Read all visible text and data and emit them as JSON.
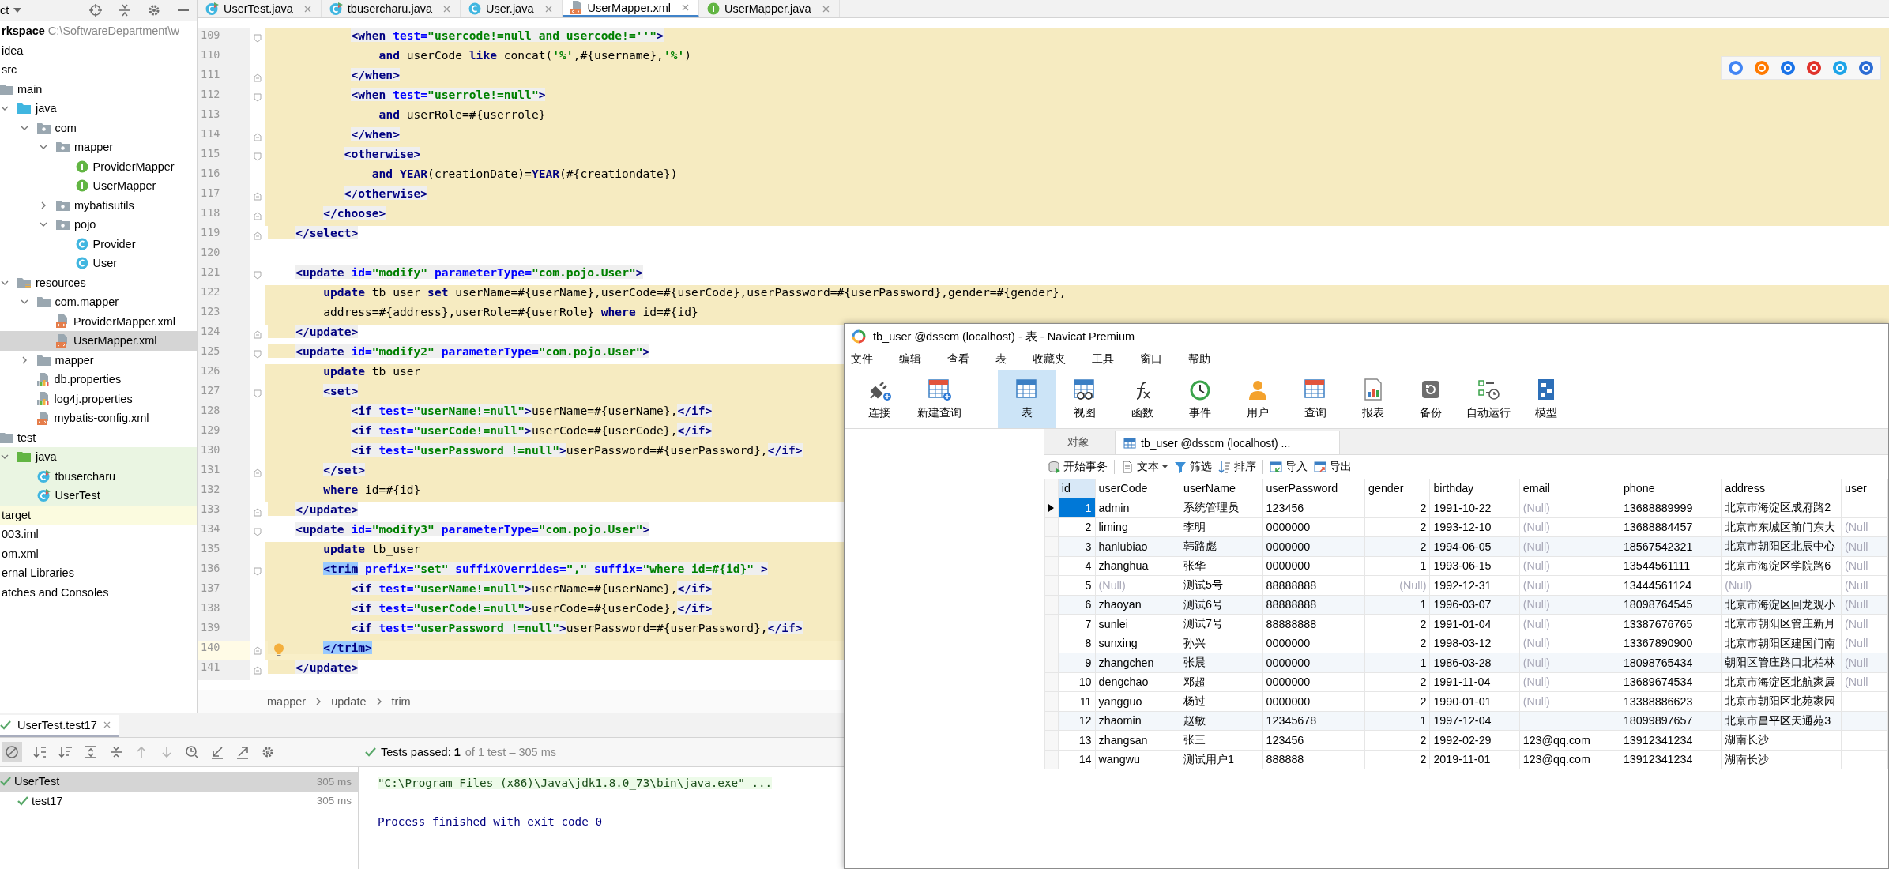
{
  "project": {
    "header": "ct",
    "tree": [
      {
        "label": "rkspace",
        "path": "C:\\SoftwareDepartment\\w",
        "selected": false,
        "children": [
          {
            "label": "idea",
            "selected": false
          },
          {
            "label": "src",
            "selected": false,
            "children": [
              {
                "label": "main",
                "kind": "folder",
                "selected": false,
                "children": [
                  {
                    "label": "java",
                    "kind": "source",
                    "expanded": true,
                    "selected": false,
                    "children": [
                      {
                        "label": "com",
                        "kind": "package",
                        "expanded": true,
                        "selected": false,
                        "children": [
                          {
                            "label": "mapper",
                            "kind": "package",
                            "expanded": true,
                            "selected": false,
                            "children": [
                              {
                                "label": "ProviderMapper",
                                "kind": "interface",
                                "selected": false
                              },
                              {
                                "label": "UserMapper",
                                "kind": "interface",
                                "selected": false
                              }
                            ]
                          },
                          {
                            "label": "mybatisutils",
                            "kind": "package",
                            "expanded": false,
                            "selected": false
                          },
                          {
                            "label": "pojo",
                            "kind": "package",
                            "expanded": true,
                            "selected": false,
                            "children": [
                              {
                                "label": "Provider",
                                "kind": "class",
                                "selected": false
                              },
                              {
                                "label": "User",
                                "kind": "class",
                                "selected": false
                              }
                            ]
                          }
                        ]
                      }
                    ]
                  },
                  {
                    "label": "resources",
                    "kind": "resources",
                    "expanded": true,
                    "selected": false,
                    "children": [
                      {
                        "label": "com.mapper",
                        "kind": "folder",
                        "expanded": true,
                        "selected": false,
                        "children": [
                          {
                            "label": "ProviderMapper.xml",
                            "kind": "xml",
                            "selected": false
                          },
                          {
                            "label": "UserMapper.xml",
                            "kind": "xml",
                            "selected": true
                          }
                        ]
                      },
                      {
                        "label": "mapper",
                        "kind": "folder",
                        "expanded": false,
                        "selected": false
                      },
                      {
                        "label": "db.properties",
                        "kind": "properties",
                        "selected": false
                      },
                      {
                        "label": "log4j.properties",
                        "kind": "properties",
                        "selected": false
                      },
                      {
                        "label": "mybatis-config.xml",
                        "kind": "xml",
                        "selected": false
                      }
                    ]
                  }
                ]
              },
              {
                "label": "test",
                "kind": "folder",
                "selected": false,
                "children": [
                  {
                    "label": "java",
                    "kind": "test-source",
                    "expanded": true,
                    "test_root": true,
                    "selected": false,
                    "children": [
                      {
                        "label": "tbusercharu",
                        "kind": "test-class",
                        "selected": false
                      },
                      {
                        "label": "UserTest",
                        "kind": "test-class",
                        "selected": false
                      }
                    ]
                  }
                ]
              }
            ]
          },
          {
            "label": "target",
            "excluded": true,
            "selected": false
          },
          {
            "label": "003.iml",
            "selected": false
          },
          {
            "label": "om.xml",
            "selected": false
          }
        ]
      },
      {
        "label": "ernal Libraries",
        "selected": false
      },
      {
        "label": "atches and Consoles",
        "selected": false
      }
    ]
  },
  "editor": {
    "tabs": [
      {
        "label": "UserTest.java",
        "kind": "test-class",
        "selected": false
      },
      {
        "label": "tbusercharu.java",
        "kind": "test-class",
        "selected": false
      },
      {
        "label": "User.java",
        "kind": "class",
        "selected": false
      },
      {
        "label": "UserMapper.xml",
        "kind": "xml",
        "selected": true
      },
      {
        "label": "UserMapper.java",
        "kind": "interface",
        "selected": false
      }
    ],
    "lines": [
      {
        "n": "109",
        "kind": "full",
        "current": false,
        "fold_start": true,
        "segs": [
          {
            "kind": "tag",
            "text": "            <when"
          },
          {
            "kind": "attr",
            "text": " test="
          },
          {
            "kind": "val",
            "text": "\"usercode!=null and usercode!=''\""
          },
          {
            "kind": "tag",
            "text": ">"
          }
        ]
      },
      {
        "n": "110",
        "kind": "full",
        "current": false,
        "segs": [
          {
            "kind": "kw",
            "text": "                and"
          },
          {
            "kind": "text",
            "text": " userCode "
          },
          {
            "kind": "kw",
            "text": "like"
          },
          {
            "kind": "text",
            "text": " concat("
          },
          {
            "kind": "str",
            "text": "'%'"
          },
          {
            "kind": "text",
            "text": ",#{username},"
          },
          {
            "kind": "str",
            "text": "'%'"
          },
          {
            "kind": "text",
            "text": ")"
          }
        ]
      },
      {
        "n": "111",
        "kind": "full",
        "current": false,
        "fold_end": true,
        "segs": [
          {
            "kind": "tag",
            "text": "            </when>"
          }
        ]
      },
      {
        "n": "112",
        "kind": "full",
        "current": false,
        "fold_start": true,
        "segs": [
          {
            "kind": "tag",
            "text": "            <when"
          },
          {
            "kind": "attr",
            "text": " test="
          },
          {
            "kind": "val",
            "text": "\"userrole!=null\""
          },
          {
            "kind": "tag",
            "text": ">"
          }
        ]
      },
      {
        "n": "113",
        "kind": "full",
        "current": false,
        "segs": [
          {
            "kind": "kw",
            "text": "                and"
          },
          {
            "kind": "text",
            "text": " userRole=#{userrole}"
          }
        ]
      },
      {
        "n": "114",
        "kind": "full",
        "current": false,
        "fold_end": true,
        "segs": [
          {
            "kind": "tag",
            "text": "            </when>"
          }
        ]
      },
      {
        "n": "115",
        "kind": "full",
        "current": false,
        "fold_start": true,
        "segs": [
          {
            "kind": "tag",
            "text": "           <otherwise>"
          }
        ]
      },
      {
        "n": "116",
        "kind": "full",
        "current": false,
        "segs": [
          {
            "kind": "kw",
            "text": "               and YEAR"
          },
          {
            "kind": "text",
            "text": "(creationDate)="
          },
          {
            "kind": "kw",
            "text": "YEAR"
          },
          {
            "kind": "text",
            "text": "(#{creationdate})"
          }
        ]
      },
      {
        "n": "117",
        "kind": "full",
        "current": false,
        "fold_end": true,
        "segs": [
          {
            "kind": "tag",
            "text": "           </otherwise>"
          }
        ]
      },
      {
        "n": "118",
        "kind": "full",
        "current": false,
        "fold_end": true,
        "segs": [
          {
            "kind": "tag",
            "text": "        </choose>"
          }
        ]
      },
      {
        "n": "119",
        "kind": "indent",
        "current": false,
        "fold_end": true,
        "segs": [
          {
            "kind": "tag",
            "text": "    </select>"
          }
        ]
      },
      {
        "n": "120",
        "kind": "none",
        "current": false
      },
      {
        "n": "121",
        "kind": "none",
        "current": false,
        "fold_start": true,
        "segs": [
          {
            "kind": "tag",
            "text": "    <update"
          },
          {
            "kind": "attr",
            "text": " id="
          },
          {
            "kind": "val",
            "text": "\"modify\""
          },
          {
            "kind": "attr",
            "text": " parameterType="
          },
          {
            "kind": "val",
            "text": "\"com.pojo.User\""
          },
          {
            "kind": "tag",
            "text": ">"
          }
        ]
      },
      {
        "n": "122",
        "kind": "full",
        "current": false,
        "segs": [
          {
            "kind": "kw",
            "text": "        update"
          },
          {
            "kind": "text",
            "text": " tb_user "
          },
          {
            "kind": "kw",
            "text": "set"
          },
          {
            "kind": "text",
            "text": " userName=#{userName},userCode=#{userCode},userPassword=#{userPassword},gender=#{gender},"
          }
        ]
      },
      {
        "n": "123",
        "kind": "full",
        "current": false,
        "segs": [
          {
            "kind": "text",
            "text": "        address=#{address},userRole=#{userRole} "
          },
          {
            "kind": "kw",
            "text": "where"
          },
          {
            "kind": "text",
            "text": " id=#{id}"
          }
        ]
      },
      {
        "n": "124",
        "kind": "indent",
        "current": false,
        "fold_end": true,
        "segs": [
          {
            "kind": "tag",
            "text": "    </update>"
          }
        ]
      },
      {
        "n": "125",
        "kind": "indent",
        "current": false,
        "fold_start": true,
        "segs": [
          {
            "kind": "tag",
            "text": "    <update"
          },
          {
            "kind": "attr",
            "text": " id="
          },
          {
            "kind": "val",
            "text": "\"modify2\""
          },
          {
            "kind": "attr",
            "text": " parameterType="
          },
          {
            "kind": "val",
            "text": "\"com.pojo.User\""
          },
          {
            "kind": "tag",
            "text": ">"
          }
        ]
      },
      {
        "n": "126",
        "kind": "full",
        "current": false,
        "segs": [
          {
            "kind": "kw",
            "text": "        update"
          },
          {
            "kind": "text",
            "text": " tb_user"
          }
        ]
      },
      {
        "n": "127",
        "kind": "full",
        "current": false,
        "fold_start": true,
        "segs": [
          {
            "kind": "tag",
            "text": "        <set>"
          }
        ]
      },
      {
        "n": "128",
        "kind": "full",
        "current": false,
        "segs": [
          {
            "kind": "tag",
            "text": "            <if"
          },
          {
            "kind": "attr",
            "text": " test="
          },
          {
            "kind": "val",
            "text": "\"userName!=null\""
          },
          {
            "kind": "tag",
            "text": ">"
          },
          {
            "kind": "text",
            "text": "userName=#{userName},"
          },
          {
            "kind": "tag",
            "text": "</if>"
          }
        ]
      },
      {
        "n": "129",
        "kind": "full",
        "current": false,
        "segs": [
          {
            "kind": "tag",
            "text": "            <if"
          },
          {
            "kind": "attr",
            "text": " test="
          },
          {
            "kind": "val",
            "text": "\"userCode!=null\""
          },
          {
            "kind": "tag",
            "text": ">"
          },
          {
            "kind": "text",
            "text": "userCode=#{userCode},"
          },
          {
            "kind": "tag",
            "text": "</if>"
          }
        ]
      },
      {
        "n": "130",
        "kind": "full",
        "current": false,
        "segs": [
          {
            "kind": "tag",
            "text": "            <if"
          },
          {
            "kind": "attr",
            "text": " test="
          },
          {
            "kind": "val",
            "text": "\"userPassword !=null\""
          },
          {
            "kind": "tag",
            "text": ">"
          },
          {
            "kind": "text",
            "text": "userPassword=#{userPassword},"
          },
          {
            "kind": "tag",
            "text": "</if>"
          }
        ]
      },
      {
        "n": "131",
        "kind": "full",
        "current": false,
        "fold_end": true,
        "segs": [
          {
            "kind": "tag",
            "text": "        </set>"
          }
        ]
      },
      {
        "n": "132",
        "kind": "full",
        "current": false,
        "segs": [
          {
            "kind": "kw",
            "text": "        where"
          },
          {
            "kind": "text",
            "text": " id=#{id}"
          }
        ]
      },
      {
        "n": "133",
        "kind": "indent",
        "current": false,
        "fold_end": true,
        "segs": [
          {
            "kind": "tag",
            "text": "    </update>"
          }
        ]
      },
      {
        "n": "134",
        "kind": "none",
        "current": false,
        "fold_start": true,
        "segs": [
          {
            "kind": "tag",
            "text": "    <update"
          },
          {
            "kind": "attr",
            "text": " id="
          },
          {
            "kind": "val",
            "text": "\"modify3\""
          },
          {
            "kind": "attr",
            "text": " parameterType="
          },
          {
            "kind": "val",
            "text": "\"com.pojo.User\""
          },
          {
            "kind": "tag",
            "text": ">"
          }
        ]
      },
      {
        "n": "135",
        "kind": "full",
        "current": false,
        "segs": [
          {
            "kind": "kw",
            "text": "        update"
          },
          {
            "kind": "text",
            "text": " tb_user"
          }
        ]
      },
      {
        "n": "136",
        "kind": "full",
        "current": false,
        "fold_start": true,
        "segs": [
          {
            "kind": "match",
            "text": "        <trim"
          },
          {
            "kind": "attr",
            "text": " prefix="
          },
          {
            "kind": "val",
            "text": "\"set\""
          },
          {
            "kind": "attr",
            "text": " suffixOverrides="
          },
          {
            "kind": "val",
            "text": "\",\""
          },
          {
            "kind": "attr",
            "text": " suffix="
          },
          {
            "kind": "val",
            "text": "\"where id=#{id}\""
          },
          {
            "kind": "tag",
            "text": " >"
          }
        ]
      },
      {
        "n": "137",
        "kind": "full",
        "current": false,
        "segs": [
          {
            "kind": "tag",
            "text": "            <if"
          },
          {
            "kind": "attr",
            "text": " test="
          },
          {
            "kind": "val",
            "text": "\"userName!=null\""
          },
          {
            "kind": "tag",
            "text": ">"
          },
          {
            "kind": "text",
            "text": "userName=#{userName},"
          },
          {
            "kind": "tag",
            "text": "</if>"
          }
        ]
      },
      {
        "n": "138",
        "kind": "full",
        "current": false,
        "segs": [
          {
            "kind": "tag",
            "text": "            <if"
          },
          {
            "kind": "attr",
            "text": " test="
          },
          {
            "kind": "val",
            "text": "\"userCode!=null\""
          },
          {
            "kind": "tag",
            "text": ">"
          },
          {
            "kind": "text",
            "text": "userCode=#{userCode},"
          },
          {
            "kind": "tag",
            "text": "</if>"
          }
        ]
      },
      {
        "n": "139",
        "kind": "full",
        "current": false,
        "segs": [
          {
            "kind": "tag",
            "text": "            <if"
          },
          {
            "kind": "attr",
            "text": " test="
          },
          {
            "kind": "val",
            "text": "\"userPassword !=null\""
          },
          {
            "kind": "tag",
            "text": ">"
          },
          {
            "kind": "text",
            "text": "userPassword=#{userPassword},"
          },
          {
            "kind": "tag",
            "text": "</if>"
          }
        ]
      },
      {
        "n": "140",
        "kind": "full",
        "current": true,
        "fold_end": true,
        "segs": [
          {
            "kind": "match",
            "text": "        </trim>"
          }
        ]
      },
      {
        "n": "141",
        "kind": "indent",
        "current": false,
        "fold_end": true,
        "segs": [
          {
            "kind": "tag",
            "text": "    </update>"
          }
        ]
      }
    ],
    "breadcrumb": [
      "mapper",
      "update",
      "trim"
    ]
  },
  "run": {
    "tab": "UserTest.test17",
    "status": "Tests passed: **1**",
    "status_detail": "of 1 test – 305 ms",
    "tests": [
      {
        "name": "UserTest",
        "time": "305 ms",
        "selected": true,
        "children": [
          {
            "name": "test17",
            "time": "305 ms",
            "selected": false
          }
        ]
      }
    ],
    "console": [
      {
        "text": "\"C:\\Program Files (x86)\\Java\\jdk1.8.0_73\\bin\\java.exe\" ...",
        "kind": "command"
      },
      {
        "text": "Process finished with exit code 0",
        "kind": "exit"
      }
    ]
  },
  "navicat": {
    "title": "tb_user @dsscm (localhost) - 表 - Navicat Premium",
    "menu": [
      "文件",
      "编辑",
      "查看",
      "表",
      "收藏夹",
      "工具",
      "窗口",
      "帮助"
    ],
    "toolbar": [
      {
        "label": "连接",
        "kind": "connect",
        "selected": false
      },
      {
        "label": "新建查询",
        "kind": "new-query",
        "selected": false
      },
      {
        "label": "表",
        "kind": "table",
        "selected": true
      },
      {
        "label": "视图",
        "kind": "view",
        "selected": false
      },
      {
        "label": "函数",
        "kind": "function",
        "selected": false
      },
      {
        "label": "事件",
        "kind": "event",
        "selected": false
      },
      {
        "label": "用户",
        "kind": "user",
        "selected": false
      },
      {
        "label": "查询",
        "kind": "query",
        "selected": false
      },
      {
        "label": "报表",
        "kind": "report",
        "selected": false
      },
      {
        "label": "备份",
        "kind": "backup",
        "selected": false
      },
      {
        "label": "自动运行",
        "kind": "schedule",
        "selected": false
      },
      {
        "label": "模型",
        "kind": "model",
        "selected": false
      }
    ],
    "tabs": [
      {
        "label": "对象",
        "kind": "objects",
        "selected": false
      },
      {
        "label": "tb_user @dsscm (localhost) ...",
        "kind": "table",
        "selected": true
      }
    ],
    "actions": [
      {
        "label": "开始事务",
        "kind": "transaction"
      },
      {
        "label": "文本",
        "kind": "text"
      },
      {
        "label": "筛选",
        "kind": "filter"
      },
      {
        "label": "排序",
        "kind": "sort"
      },
      {
        "label": "导入",
        "kind": "import"
      },
      {
        "label": "导出",
        "kind": "export"
      }
    ],
    "table": {
      "columns": [
        "id",
        "userCode",
        "userName",
        "userPassword",
        "gender",
        "birthday",
        "email",
        "phone",
        "address",
        "user"
      ],
      "rows": [
        {
          "selected": true,
          "cells": [
            "1",
            "admin",
            "系统管理员",
            "123456",
            "2",
            "1991-10-22",
            {
              "text": "(Null)",
              "is_null": true
            },
            "13688889999",
            "北京市海淀区成府路2",
            null
          ]
        },
        {
          "selected": false,
          "cells": [
            "2",
            "liming",
            "李明",
            "0000000",
            "2",
            "1993-12-10",
            {
              "text": "(Null)",
              "is_null": true
            },
            "13688884457",
            "北京市东城区前门东大",
            {
              "text": "(Null",
              "is_null": true
            }
          ]
        },
        {
          "selected": false,
          "cells": [
            "3",
            "hanlubiao",
            "韩路彪",
            "0000000",
            "2",
            "1994-06-05",
            {
              "text": "(Null)",
              "is_null": true
            },
            "18567542321",
            "北京市朝阳区北辰中心",
            {
              "text": "(Null",
              "is_null": true
            }
          ]
        },
        {
          "selected": false,
          "cells": [
            "4",
            "zhanghua",
            "张华",
            "0000000",
            "1",
            "1993-06-15",
            {
              "text": "(Null)",
              "is_null": true
            },
            "13544561111",
            "北京市海淀区学院路6",
            {
              "text": "(Null",
              "is_null": true
            }
          ]
        },
        {
          "selected": false,
          "cells": [
            "5",
            {
              "text": "(Null)",
              "is_null": true
            },
            "测试5号",
            "88888888",
            {
              "text": "(Null)",
              "is_null": true
            },
            "1992-12-31",
            {
              "text": "(Null)",
              "is_null": true
            },
            "13444561124",
            {
              "text": "(Null)",
              "is_null": true
            },
            {
              "text": "(Null",
              "is_null": true
            }
          ]
        },
        {
          "selected": false,
          "cells": [
            "6",
            "zhaoyan",
            "测试6号",
            "88888888",
            "1",
            "1996-03-07",
            {
              "text": "(Null)",
              "is_null": true
            },
            "18098764545",
            "北京市海淀区回龙观小",
            {
              "text": "(Null",
              "is_null": true
            }
          ]
        },
        {
          "selected": false,
          "cells": [
            "7",
            "sunlei",
            "测试7号",
            "88888888",
            "2",
            "1991-01-04",
            {
              "text": "(Null)",
              "is_null": true
            },
            "13387676765",
            "北京市朝阳区管庄新月",
            {
              "text": "(Null",
              "is_null": true
            }
          ]
        },
        {
          "selected": false,
          "cells": [
            "8",
            "sunxing",
            "孙兴",
            "0000000",
            "2",
            "1998-03-12",
            {
              "text": "(Null)",
              "is_null": true
            },
            "13367890900",
            "北京市朝阳区建国门南",
            {
              "text": "(Null",
              "is_null": true
            }
          ]
        },
        {
          "selected": false,
          "cells": [
            "9",
            "zhangchen",
            "张晨",
            "0000000",
            "1",
            "1986-03-28",
            {
              "text": "(Null)",
              "is_null": true
            },
            "18098765434",
            "朝阳区管庄路口北柏林",
            {
              "text": "(Null",
              "is_null": true
            }
          ]
        },
        {
          "selected": false,
          "cells": [
            "10",
            "dengchao",
            "邓超",
            "0000000",
            "2",
            "1991-11-04",
            {
              "text": "(Null)",
              "is_null": true
            },
            "13689674534",
            "北京市海淀区北航家属",
            {
              "text": "(Null",
              "is_null": true
            }
          ]
        },
        {
          "selected": false,
          "cells": [
            "11",
            "yangguo",
            "杨过",
            "0000000",
            "2",
            "1990-01-01",
            {
              "text": "(Null)",
              "is_null": true
            },
            "13388886623",
            "北京市朝阳区北苑家园",
            null
          ]
        },
        {
          "selected": false,
          "cells": [
            "12",
            "zhaomin",
            "赵敏",
            "12345678",
            "1",
            "1997-12-04",
            null,
            "18099897657",
            "北京市昌平区天通苑3",
            null
          ]
        },
        {
          "selected": false,
          "cells": [
            "13",
            "zhangsan",
            "张三",
            "123456",
            "2",
            "1992-02-29",
            "123@qq.com",
            "13912341234",
            "湖南长沙",
            null
          ]
        },
        {
          "selected": false,
          "cells": [
            "14",
            "wangwu",
            "测试用户1",
            "888888",
            "2",
            "2019-11-01",
            "123@qq.com",
            "13912341234",
            "湖南长沙",
            null
          ]
        }
      ]
    }
  }
}
